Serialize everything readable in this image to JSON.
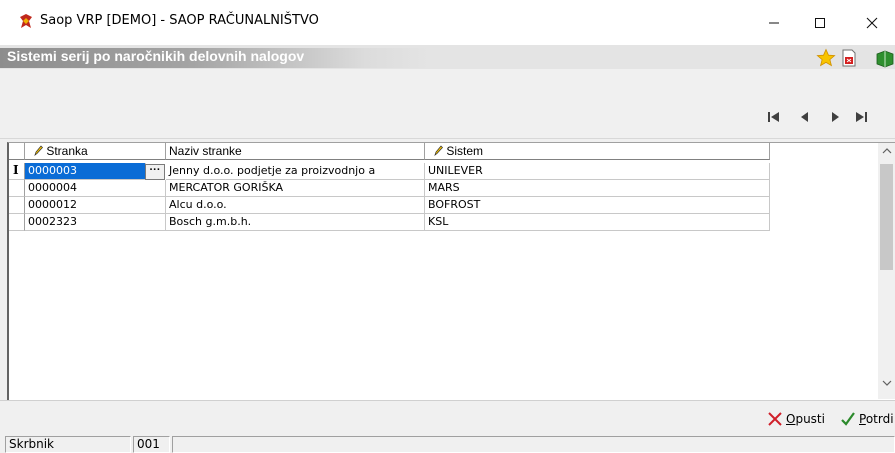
{
  "window": {
    "title": "Saop VRP [DEMO] - SAOP RAČUNALNIŠTVO",
    "min_glyph": "—",
    "max_glyph": "☐",
    "close_glyph": "✕"
  },
  "caption": {
    "text": "Sistemi serij po naročnikih delovnih nalogov"
  },
  "navigator": {
    "first": "first-record",
    "prev": "previous-record",
    "next": "next-record",
    "last": "last-record"
  },
  "grid": {
    "columns": [
      {
        "label": "Stranka",
        "editable": true
      },
      {
        "label": "Naziv stranke",
        "editable": false
      },
      {
        "label": "Sistem",
        "editable": true
      }
    ],
    "rows": [
      {
        "stranka": "0000003",
        "naziv": "Jenny d.o.o. podjetje za proizvodnjo a",
        "sistem": "UNILEVER"
      },
      {
        "stranka": "0000004",
        "naziv": "MERCATOR GORIŠKA",
        "sistem": "MARS"
      },
      {
        "stranka": "0000012",
        "naziv": "Alcu d.o.o.",
        "sistem": "BOFROST"
      },
      {
        "stranka": "0002323",
        "naziv": "Bosch g.m.b.h.",
        "sistem": "KSL"
      }
    ],
    "ellipsis": "···",
    "row_indicator": "I"
  },
  "actions": {
    "cancel_prefix": "",
    "cancel_underline": "O",
    "cancel_rest": "pusti",
    "confirm_underline": "P",
    "confirm_rest": "otrdi"
  },
  "status": {
    "user_label": "Skrbnik",
    "code": "001",
    "message": ""
  },
  "colors": {
    "selection": "#0a6cd6",
    "cancel_icon": "#d0202a",
    "confirm_icon": "#2c8a2c"
  }
}
